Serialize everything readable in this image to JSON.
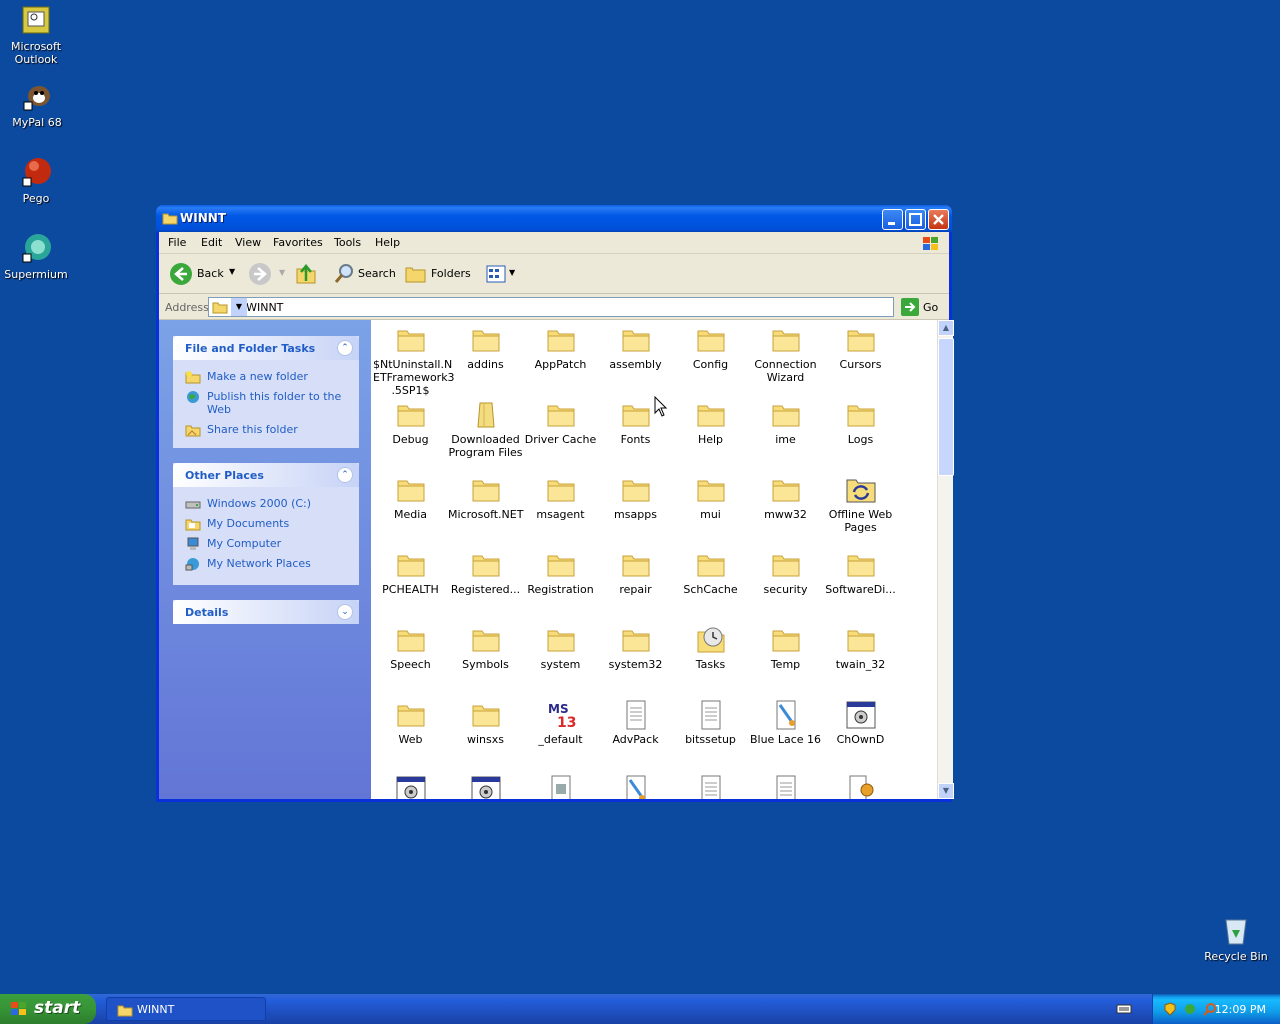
{
  "desktop": {
    "icons": [
      {
        "label": "Microsoft\nOutlook",
        "icon": "outlook-icon"
      },
      {
        "label": "MyPal 68",
        "icon": "mypal-icon"
      },
      {
        "label": "Pego",
        "icon": "pego-icon"
      },
      {
        "label": "Supermium",
        "icon": "supermium-icon"
      },
      {
        "label": "Recycle Bin",
        "icon": "recycle-bin-icon"
      }
    ]
  },
  "window": {
    "title": "WINNT",
    "menu": [
      "File",
      "Edit",
      "View",
      "Favorites",
      "Tools",
      "Help"
    ],
    "toolbar": {
      "back": "Back",
      "search": "Search",
      "folders": "Folders"
    },
    "address": {
      "label": "Address",
      "value": "C:\\WINNT",
      "go": "Go"
    }
  },
  "tasks": {
    "file_folder": {
      "title": "File and Folder Tasks",
      "items": [
        "Make a new folder",
        "Publish this folder to the Web",
        "Share this folder"
      ]
    },
    "other_places": {
      "title": "Other Places",
      "items": [
        "Windows 2000 (C:)",
        "My Documents",
        "My Computer",
        "My Network Places"
      ]
    },
    "details": {
      "title": "Details"
    }
  },
  "files": [
    {
      "name": "$NtUninstall.NETFramework3.5SP1$",
      "display": "$NtUninstall.N\nETFramework3\n.5SP1$",
      "type": "folder"
    },
    {
      "name": "addins",
      "type": "folder"
    },
    {
      "name": "AppPatch",
      "type": "folder"
    },
    {
      "name": "assembly",
      "type": "folder"
    },
    {
      "name": "Config",
      "type": "folder"
    },
    {
      "name": "Connection Wizard",
      "display": "Connection\nWizard",
      "type": "folder"
    },
    {
      "name": "Cursors",
      "type": "folder"
    },
    {
      "name": "Debug",
      "type": "folder"
    },
    {
      "name": "Downloaded Program Files",
      "display": "Downloaded\nProgram Files",
      "type": "folder-special"
    },
    {
      "name": "Driver Cache",
      "type": "folder"
    },
    {
      "name": "Fonts",
      "type": "folder"
    },
    {
      "name": "Help",
      "type": "folder"
    },
    {
      "name": "ime",
      "type": "folder"
    },
    {
      "name": "Logs",
      "type": "folder"
    },
    {
      "name": "Media",
      "type": "folder"
    },
    {
      "name": "Microsoft.NET",
      "type": "folder"
    },
    {
      "name": "msagent",
      "type": "folder"
    },
    {
      "name": "msapps",
      "type": "folder"
    },
    {
      "name": "mui",
      "type": "folder"
    },
    {
      "name": "mww32",
      "type": "folder"
    },
    {
      "name": "Offline Web Pages",
      "display": "Offline Web\nPages",
      "type": "offline"
    },
    {
      "name": "PCHEALTH",
      "type": "folder"
    },
    {
      "name": "Registered...",
      "type": "folder"
    },
    {
      "name": "Registration",
      "type": "folder"
    },
    {
      "name": "repair",
      "type": "folder"
    },
    {
      "name": "SchCache",
      "type": "folder"
    },
    {
      "name": "security",
      "type": "folder"
    },
    {
      "name": "SoftwareDi...",
      "type": "folder"
    },
    {
      "name": "Speech",
      "type": "folder"
    },
    {
      "name": "Symbols",
      "type": "folder"
    },
    {
      "name": "system",
      "type": "folder"
    },
    {
      "name": "system32",
      "type": "folder"
    },
    {
      "name": "Tasks",
      "type": "tasks"
    },
    {
      "name": "Temp",
      "type": "folder"
    },
    {
      "name": "twain_32",
      "type": "folder"
    },
    {
      "name": "Web",
      "type": "folder"
    },
    {
      "name": "winsxs",
      "type": "folder"
    },
    {
      "name": "_default",
      "type": "ms"
    },
    {
      "name": "AdvPack",
      "type": "doc"
    },
    {
      "name": "bitssetup",
      "type": "doc"
    },
    {
      "name": "Blue Lace 16",
      "type": "image"
    },
    {
      "name": "ChOwnD",
      "type": "app"
    },
    {
      "name": "",
      "type": "app"
    },
    {
      "name": "",
      "type": "app"
    },
    {
      "name": "",
      "type": "video"
    },
    {
      "name": "",
      "type": "image"
    },
    {
      "name": "",
      "type": "doc"
    },
    {
      "name": "",
      "type": "doc"
    },
    {
      "name": "",
      "type": "config"
    }
  ],
  "taskbar": {
    "start": "start",
    "task": "WINNT",
    "clock": "12:09 PM"
  }
}
